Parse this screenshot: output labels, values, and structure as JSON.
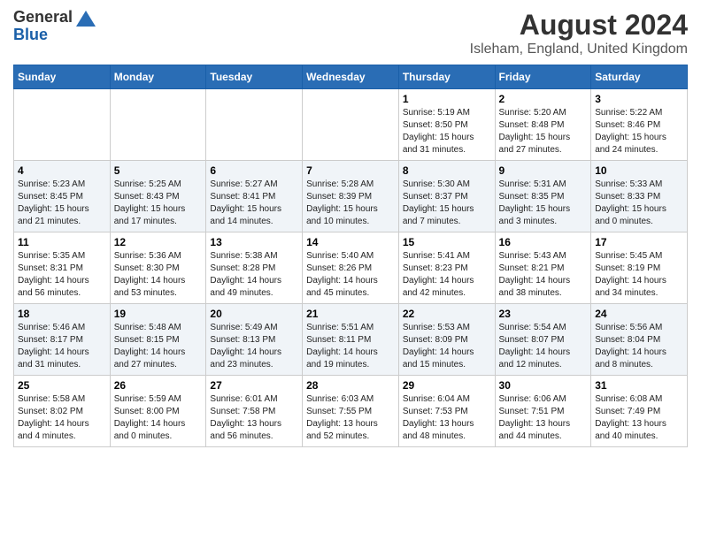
{
  "header": {
    "logo_line1": "General",
    "logo_line2": "Blue",
    "main_title": "August 2024",
    "subtitle": "Isleham, England, United Kingdom"
  },
  "weekdays": [
    "Sunday",
    "Monday",
    "Tuesday",
    "Wednesday",
    "Thursday",
    "Friday",
    "Saturday"
  ],
  "weeks": [
    {
      "days": [
        {
          "num": "",
          "info": ""
        },
        {
          "num": "",
          "info": ""
        },
        {
          "num": "",
          "info": ""
        },
        {
          "num": "",
          "info": ""
        },
        {
          "num": "1",
          "info": "Sunrise: 5:19 AM\nSunset: 8:50 PM\nDaylight: 15 hours\nand 31 minutes."
        },
        {
          "num": "2",
          "info": "Sunrise: 5:20 AM\nSunset: 8:48 PM\nDaylight: 15 hours\nand 27 minutes."
        },
        {
          "num": "3",
          "info": "Sunrise: 5:22 AM\nSunset: 8:46 PM\nDaylight: 15 hours\nand 24 minutes."
        }
      ]
    },
    {
      "days": [
        {
          "num": "4",
          "info": "Sunrise: 5:23 AM\nSunset: 8:45 PM\nDaylight: 15 hours\nand 21 minutes."
        },
        {
          "num": "5",
          "info": "Sunrise: 5:25 AM\nSunset: 8:43 PM\nDaylight: 15 hours\nand 17 minutes."
        },
        {
          "num": "6",
          "info": "Sunrise: 5:27 AM\nSunset: 8:41 PM\nDaylight: 15 hours\nand 14 minutes."
        },
        {
          "num": "7",
          "info": "Sunrise: 5:28 AM\nSunset: 8:39 PM\nDaylight: 15 hours\nand 10 minutes."
        },
        {
          "num": "8",
          "info": "Sunrise: 5:30 AM\nSunset: 8:37 PM\nDaylight: 15 hours\nand 7 minutes."
        },
        {
          "num": "9",
          "info": "Sunrise: 5:31 AM\nSunset: 8:35 PM\nDaylight: 15 hours\nand 3 minutes."
        },
        {
          "num": "10",
          "info": "Sunrise: 5:33 AM\nSunset: 8:33 PM\nDaylight: 15 hours\nand 0 minutes."
        }
      ]
    },
    {
      "days": [
        {
          "num": "11",
          "info": "Sunrise: 5:35 AM\nSunset: 8:31 PM\nDaylight: 14 hours\nand 56 minutes."
        },
        {
          "num": "12",
          "info": "Sunrise: 5:36 AM\nSunset: 8:30 PM\nDaylight: 14 hours\nand 53 minutes."
        },
        {
          "num": "13",
          "info": "Sunrise: 5:38 AM\nSunset: 8:28 PM\nDaylight: 14 hours\nand 49 minutes."
        },
        {
          "num": "14",
          "info": "Sunrise: 5:40 AM\nSunset: 8:26 PM\nDaylight: 14 hours\nand 45 minutes."
        },
        {
          "num": "15",
          "info": "Sunrise: 5:41 AM\nSunset: 8:23 PM\nDaylight: 14 hours\nand 42 minutes."
        },
        {
          "num": "16",
          "info": "Sunrise: 5:43 AM\nSunset: 8:21 PM\nDaylight: 14 hours\nand 38 minutes."
        },
        {
          "num": "17",
          "info": "Sunrise: 5:45 AM\nSunset: 8:19 PM\nDaylight: 14 hours\nand 34 minutes."
        }
      ]
    },
    {
      "days": [
        {
          "num": "18",
          "info": "Sunrise: 5:46 AM\nSunset: 8:17 PM\nDaylight: 14 hours\nand 31 minutes."
        },
        {
          "num": "19",
          "info": "Sunrise: 5:48 AM\nSunset: 8:15 PM\nDaylight: 14 hours\nand 27 minutes."
        },
        {
          "num": "20",
          "info": "Sunrise: 5:49 AM\nSunset: 8:13 PM\nDaylight: 14 hours\nand 23 minutes."
        },
        {
          "num": "21",
          "info": "Sunrise: 5:51 AM\nSunset: 8:11 PM\nDaylight: 14 hours\nand 19 minutes."
        },
        {
          "num": "22",
          "info": "Sunrise: 5:53 AM\nSunset: 8:09 PM\nDaylight: 14 hours\nand 15 minutes."
        },
        {
          "num": "23",
          "info": "Sunrise: 5:54 AM\nSunset: 8:07 PM\nDaylight: 14 hours\nand 12 minutes."
        },
        {
          "num": "24",
          "info": "Sunrise: 5:56 AM\nSunset: 8:04 PM\nDaylight: 14 hours\nand 8 minutes."
        }
      ]
    },
    {
      "days": [
        {
          "num": "25",
          "info": "Sunrise: 5:58 AM\nSunset: 8:02 PM\nDaylight: 14 hours\nand 4 minutes."
        },
        {
          "num": "26",
          "info": "Sunrise: 5:59 AM\nSunset: 8:00 PM\nDaylight: 14 hours\nand 0 minutes."
        },
        {
          "num": "27",
          "info": "Sunrise: 6:01 AM\nSunset: 7:58 PM\nDaylight: 13 hours\nand 56 minutes."
        },
        {
          "num": "28",
          "info": "Sunrise: 6:03 AM\nSunset: 7:55 PM\nDaylight: 13 hours\nand 52 minutes."
        },
        {
          "num": "29",
          "info": "Sunrise: 6:04 AM\nSunset: 7:53 PM\nDaylight: 13 hours\nand 48 minutes."
        },
        {
          "num": "30",
          "info": "Sunrise: 6:06 AM\nSunset: 7:51 PM\nDaylight: 13 hours\nand 44 minutes."
        },
        {
          "num": "31",
          "info": "Sunrise: 6:08 AM\nSunset: 7:49 PM\nDaylight: 13 hours\nand 40 minutes."
        }
      ]
    }
  ]
}
